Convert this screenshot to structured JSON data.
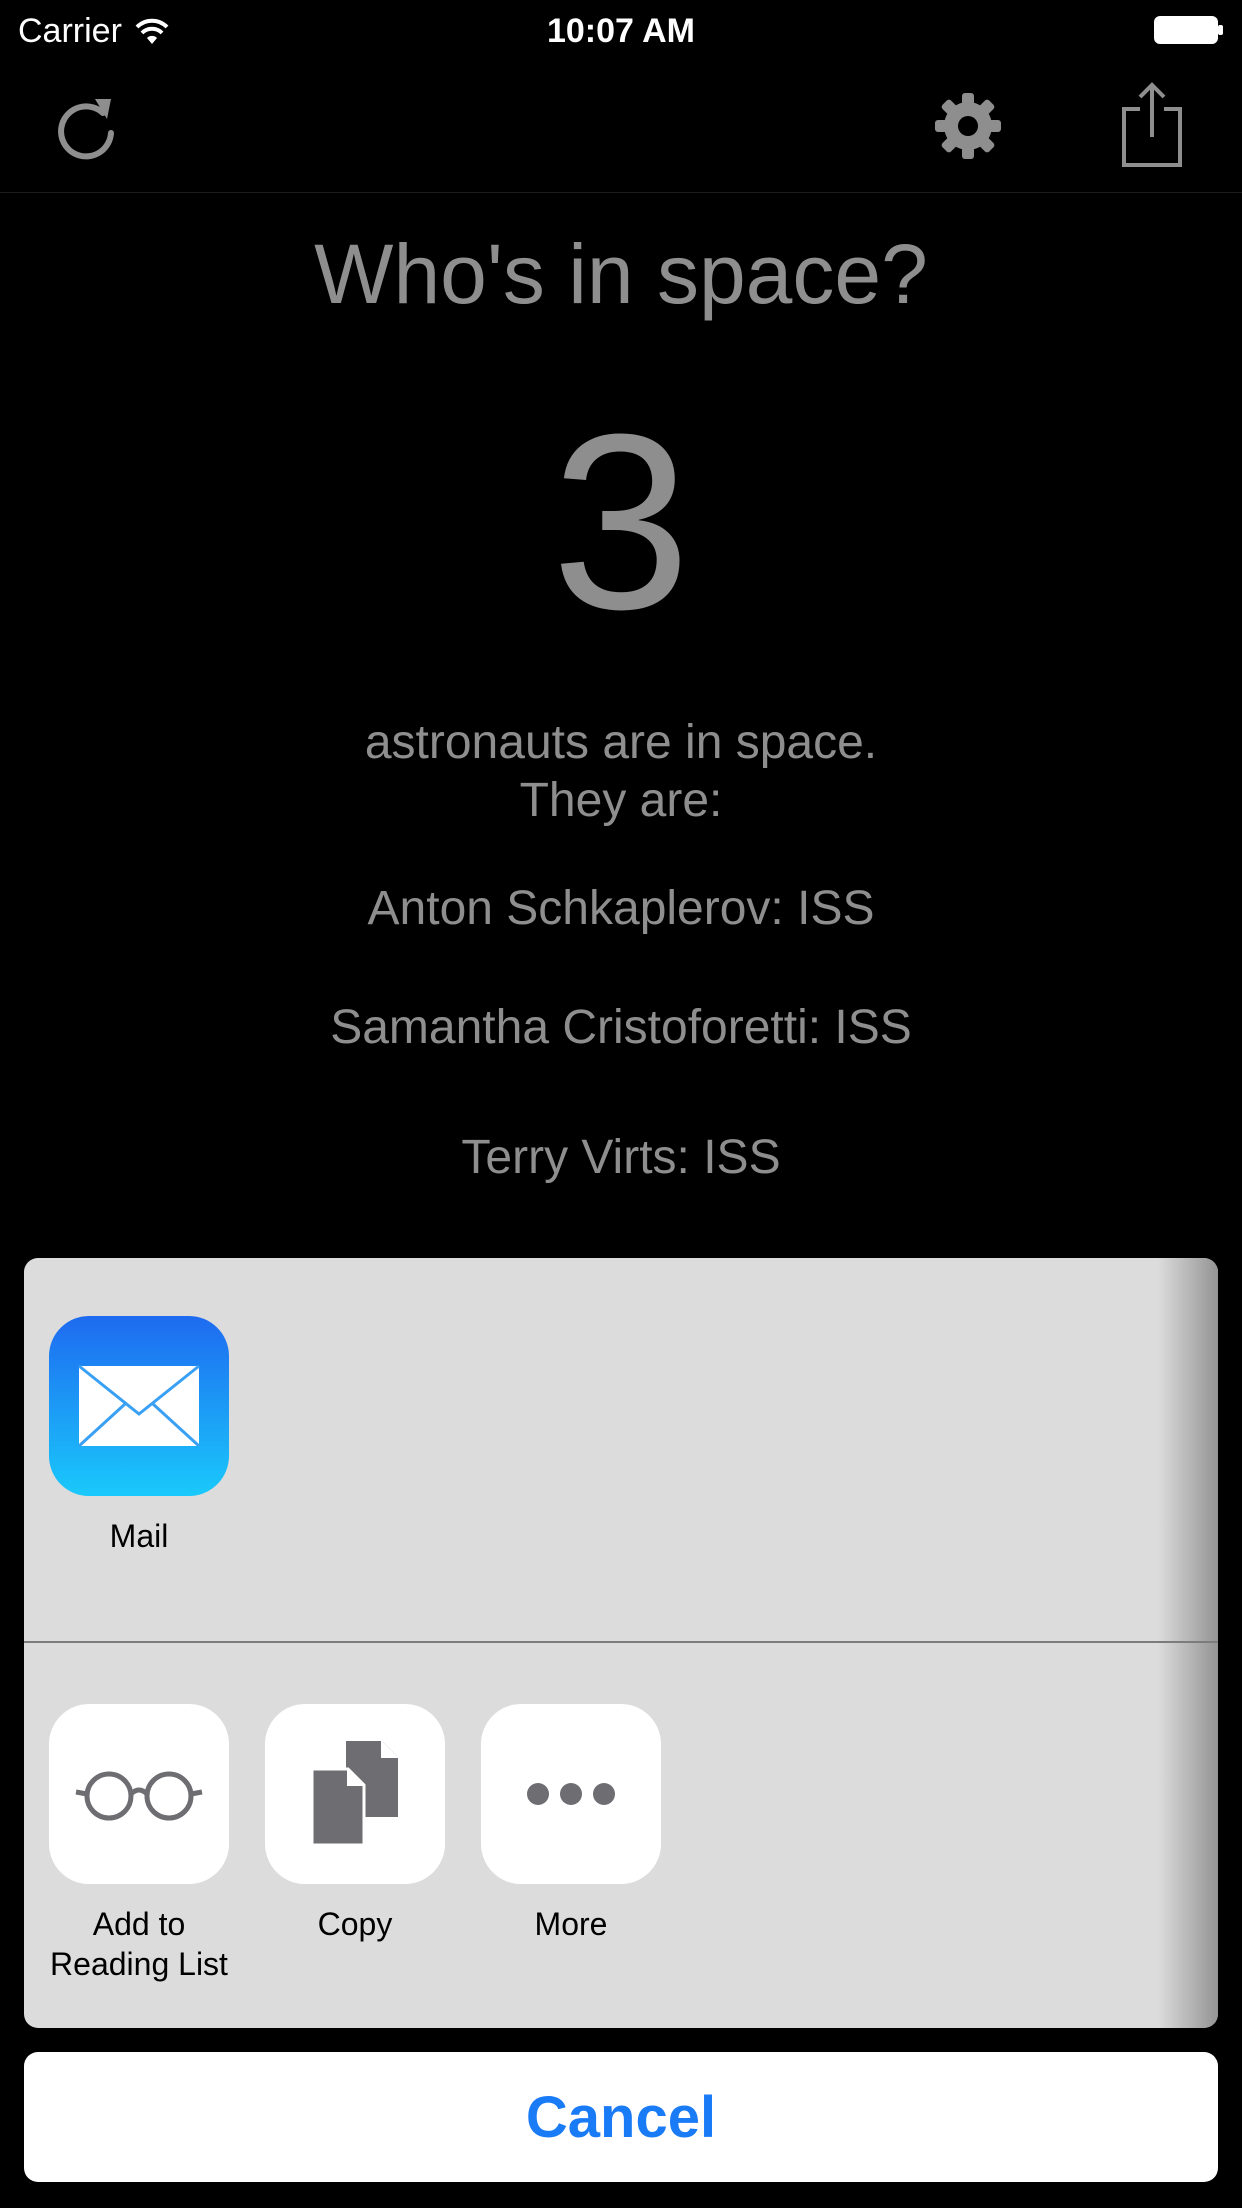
{
  "status_bar": {
    "carrier": "Carrier",
    "time": "10:07 AM"
  },
  "nav": {
    "icons": [
      "refresh-icon",
      "gear-icon",
      "share-icon"
    ]
  },
  "main": {
    "title": "Who's in space?",
    "count": "3",
    "description_line1": "astronauts are in space.",
    "description_line2": "They are:",
    "astronauts": [
      "Anton Schkaplerov: ISS",
      "Samantha Cristoforetti: ISS",
      "Terry Virts: ISS"
    ]
  },
  "share_sheet": {
    "apps": [
      {
        "label": "Mail",
        "icon": "mail-icon"
      }
    ],
    "actions": [
      {
        "label_line1": "Add to",
        "label_line2": "Reading List",
        "icon": "reading-list-icon"
      },
      {
        "label_line1": "Copy",
        "label_line2": "",
        "icon": "copy-icon"
      },
      {
        "label_line1": "More",
        "label_line2": "",
        "icon": "more-icon"
      }
    ],
    "cancel_label": "Cancel"
  },
  "colors": {
    "background": "#000000",
    "text_gray": "#8e8e8e",
    "sheet_bg": "#dcdcdc",
    "cancel_blue": "#1a7bf6"
  }
}
